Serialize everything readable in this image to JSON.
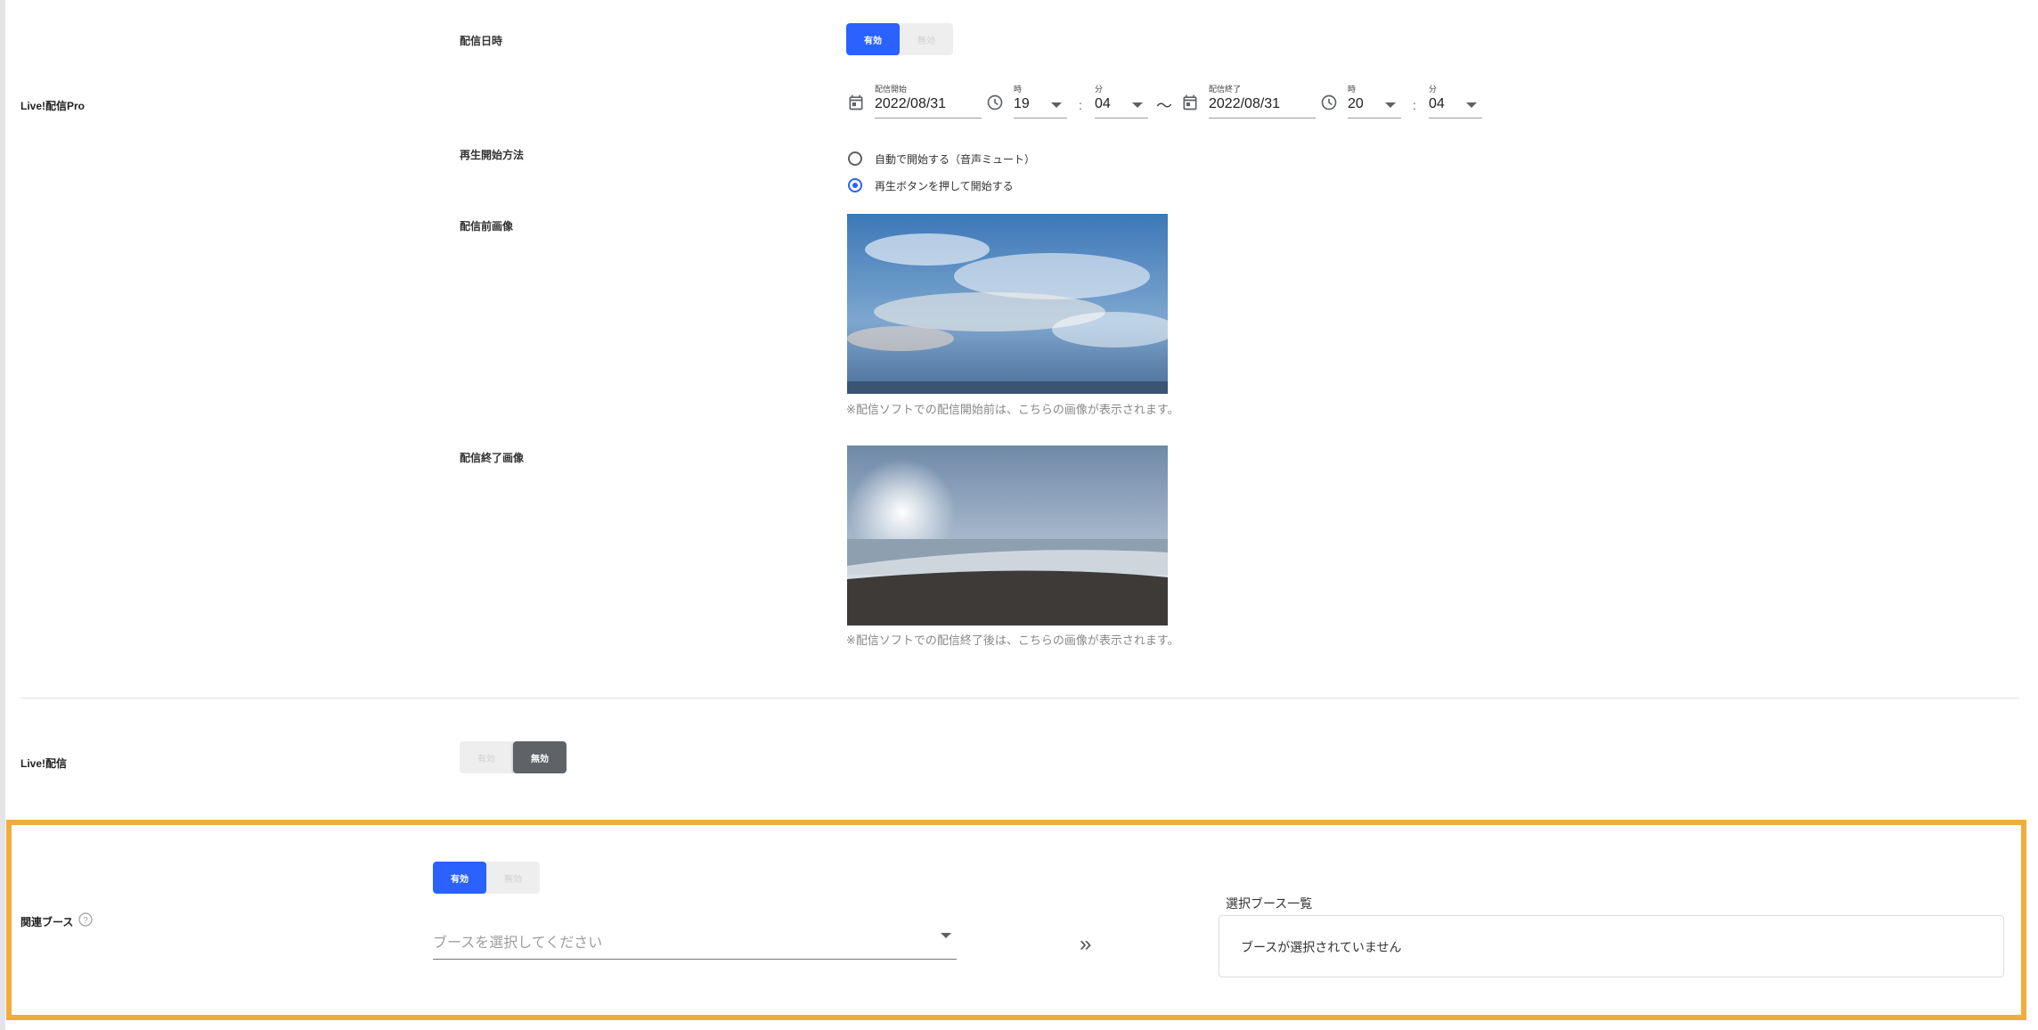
{
  "section_live_pro": {
    "label": "Live!配信Pro"
  },
  "stream_datetime": {
    "label": "配信日時",
    "toggle": {
      "on_label": "有効",
      "off_label": "無効"
    },
    "start": {
      "label": "配信開始",
      "date": "2022/08/31",
      "hour_label": "時",
      "hour": "19",
      "minute_label": "分",
      "minute": "04"
    },
    "tilde": "〜",
    "colon": ":",
    "end": {
      "label": "配信終了",
      "date": "2022/08/31",
      "hour_label": "時",
      "hour": "20",
      "minute_label": "分",
      "minute": "04"
    }
  },
  "playback_method": {
    "label": "再生開始方法",
    "options": [
      "自動で開始する（音声ミュート）",
      "再生ボタンを押して開始する"
    ],
    "selected_index": 1
  },
  "pre_image": {
    "label": "配信前画像",
    "note": "※配信ソフトでの配信開始前は、こちらの画像が表示されます。"
  },
  "post_image": {
    "label": "配信終了画像",
    "note": "※配信ソフトでの配信終了後は、こちらの画像が表示されます。"
  },
  "section_live": {
    "label": "Live!配信",
    "toggle": {
      "on_label": "有効",
      "off_label": "無効"
    }
  },
  "related_booth": {
    "label": "関連ブース",
    "toggle": {
      "on_label": "有効",
      "off_label": "無効"
    },
    "select_placeholder": "ブースを選択してください",
    "move_icon": "»",
    "selected_title": "選択ブース一覧",
    "empty_text": "ブースが選択されていません"
  },
  "colors": {
    "primary": "#2962ff",
    "highlight": "#f0ad3b",
    "dark_toggle": "#5f6368"
  }
}
